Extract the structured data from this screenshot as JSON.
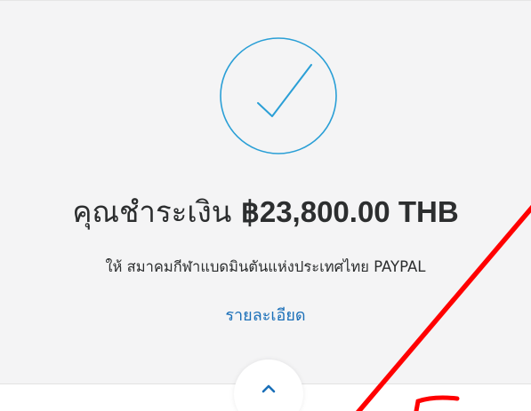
{
  "confirmation": {
    "status_icon": "check-circle-icon",
    "headline_prefix": "คุณชำระเงิน",
    "amount": "฿23,800.00 THB",
    "payee": "ให้ สมาคมกีฬาแบดมินตันแห่งประเทศไทย PAYPAL",
    "details_link": "รายละเอียด",
    "expand_icon": "chevron-up-icon"
  },
  "colors": {
    "accent": "#1a6fb8",
    "icon_stroke": "#2a9fd6",
    "annotation": "#ff0000",
    "background": "#f4f4f5",
    "text": "#2c2e2f"
  }
}
